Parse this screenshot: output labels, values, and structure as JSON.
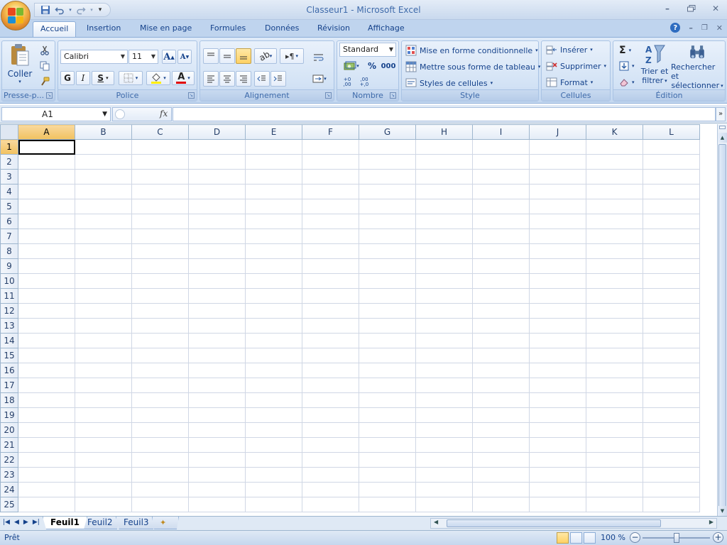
{
  "window": {
    "title": "Classeur1 - Microsoft Excel"
  },
  "ribbon_tabs": [
    "Accueil",
    "Insertion",
    "Mise en page",
    "Formules",
    "Données",
    "Révision",
    "Affichage"
  ],
  "active_tab": "Accueil",
  "groups": {
    "clipboard": {
      "label": "Presse-p...",
      "paste_label": "Coller"
    },
    "font": {
      "label": "Police",
      "font_name": "Calibri",
      "font_size": "11",
      "bold": "G",
      "italic": "I",
      "underline": "S",
      "grow": "A",
      "shrink": "A",
      "font_color_glyph": "A"
    },
    "alignment": {
      "label": "Alignement"
    },
    "number": {
      "label": "Nombre",
      "format": "Standard",
      "percent": "%",
      "thousands": "000",
      "inc_decimal": "+0 ,00",
      "dec_decimal": ",00 +,0"
    },
    "style": {
      "label": "Style",
      "conditional": "Mise en forme conditionnelle",
      "table": "Mettre sous forme de tableau",
      "cell_styles": "Styles de cellules"
    },
    "cells": {
      "label": "Cellules",
      "insert": "Insérer",
      "delete": "Supprimer",
      "format": "Format"
    },
    "editing": {
      "label": "Édition",
      "sum": "Σ",
      "sort_filter_1": "Trier et",
      "sort_filter_2": "filtrer",
      "find_select_1": "Rechercher et",
      "find_select_2": "sélectionner"
    }
  },
  "formula_bar": {
    "name_box": "A1",
    "fx": "fx",
    "formula": ""
  },
  "columns": [
    "A",
    "B",
    "C",
    "D",
    "E",
    "F",
    "G",
    "H",
    "I",
    "J",
    "K",
    "L"
  ],
  "rows": [
    "1",
    "2",
    "3",
    "4",
    "5",
    "6",
    "7",
    "8",
    "9",
    "10",
    "11",
    "12",
    "13",
    "14",
    "15",
    "16",
    "17",
    "18",
    "19",
    "20",
    "21",
    "22",
    "23",
    "24",
    "25"
  ],
  "active_cell": {
    "col": "A",
    "row": "1"
  },
  "sheets": [
    "Feuil1",
    "Feuil2",
    "Feuil3"
  ],
  "active_sheet": "Feuil1",
  "status": {
    "text": "Prêt",
    "zoom": "100 %"
  }
}
